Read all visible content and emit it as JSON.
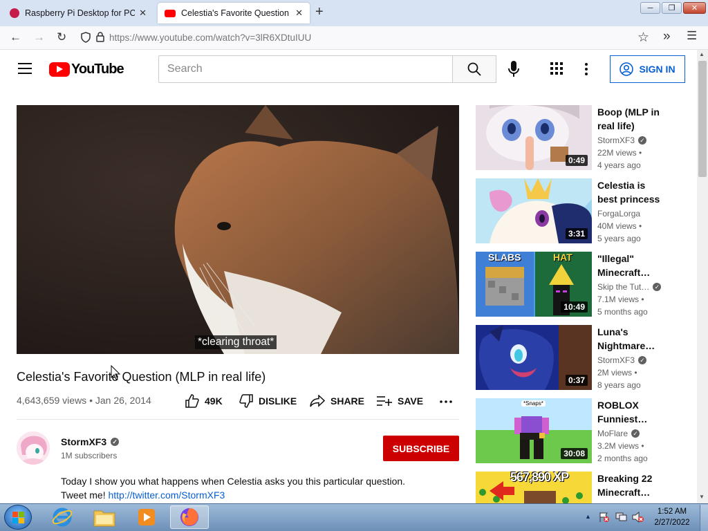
{
  "browser": {
    "tabs": [
      {
        "title": "Raspberry Pi Desktop for PC an",
        "active": false
      },
      {
        "title": "Celestia's Favorite Question (MLP",
        "active": true
      }
    ],
    "url": "https://www.youtube.com/watch?v=3lR6XDtuIUU",
    "close_glyph": "✕"
  },
  "masthead": {
    "logo_text": "YouTube",
    "search_placeholder": "Search",
    "signin_label": "SIGN IN"
  },
  "player": {
    "caption": "*clearing throat*"
  },
  "video": {
    "title": "Celestia's Favorite Question (MLP in real life)",
    "meta": "4,643,659 views • Jan 26, 2014",
    "likes": "49K",
    "dislike_label": "DISLIKE",
    "share_label": "SHARE",
    "save_label": "SAVE"
  },
  "channel": {
    "name": "StormXF3",
    "subscribers": "1M subscribers",
    "subscribe_label": "SUBSCRIBE"
  },
  "description": {
    "line1": "Today I show you what happens when Celestia asks you this particular question.",
    "line2_prefix": "Tweet me! ",
    "line2_link": "http://twitter.com/StormXF3"
  },
  "recommendations": [
    {
      "title": "Boop (MLP in real life)",
      "channel": "StormXF3",
      "verified": true,
      "views": "22M views •",
      "age": "4 years ago",
      "duration": "0:49"
    },
    {
      "title": "Celestia is best princess",
      "channel": "ForgaLorga",
      "verified": false,
      "views": "40M views •",
      "age": "5 years ago",
      "duration": "3:31"
    },
    {
      "title": "\"Illegal\" Minecraft…",
      "channel": "Skip the Tut…",
      "verified": true,
      "views": "7.1M views •",
      "age": "5 months ago",
      "duration": "10:49",
      "thumb_text_left": "SLABS",
      "thumb_text_right": "HAT"
    },
    {
      "title": "Luna's Nightmare…",
      "channel": "StormXF3",
      "verified": true,
      "views": "2M views •",
      "age": "8 years ago",
      "duration": "0:37"
    },
    {
      "title": "ROBLOX Funniest…",
      "channel": "MoFlare",
      "verified": true,
      "views": "3.2M views •",
      "age": "2 months ago",
      "duration": "30:08",
      "thumb_text": "*Snaps*"
    },
    {
      "title": "Breaking 22 Minecraft…",
      "channel": "",
      "verified": false,
      "views": "",
      "age": "",
      "duration": "",
      "thumb_text": "567,890 XP"
    }
  ],
  "taskbar": {
    "time": "1:52 AM",
    "date": "2/27/2022"
  },
  "colors": {
    "yt_red": "#ff0000",
    "subscribe_red": "#cc0000",
    "link_blue": "#065fd4"
  }
}
